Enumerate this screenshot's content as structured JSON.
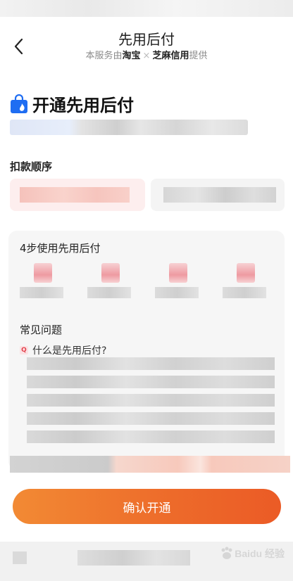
{
  "header": {
    "title": "先用后付",
    "subtitle_prefix": "本服务由",
    "provider_a": "淘宝",
    "separator": "×",
    "provider_b": "芝麻信用",
    "subtitle_suffix": "提供",
    "back_icon": "chevron-left-icon"
  },
  "main": {
    "open_title": "开通先用后付",
    "open_icon": "shopping-bag-icon",
    "order_label": "扣款顺序",
    "steps_title": "4步使用先用后付",
    "faq_title": "常见问题",
    "faq_badge": "Q",
    "faq_question": "什么是先用后付?",
    "confirm_label": "确认开通"
  },
  "watermark": {
    "text": "Baidu 经验"
  },
  "colors": {
    "accent": "#ed6a2a",
    "accent_start": "#f28a34",
    "bag_icon": "#1f6df2",
    "question_badge": "#e4434e"
  }
}
